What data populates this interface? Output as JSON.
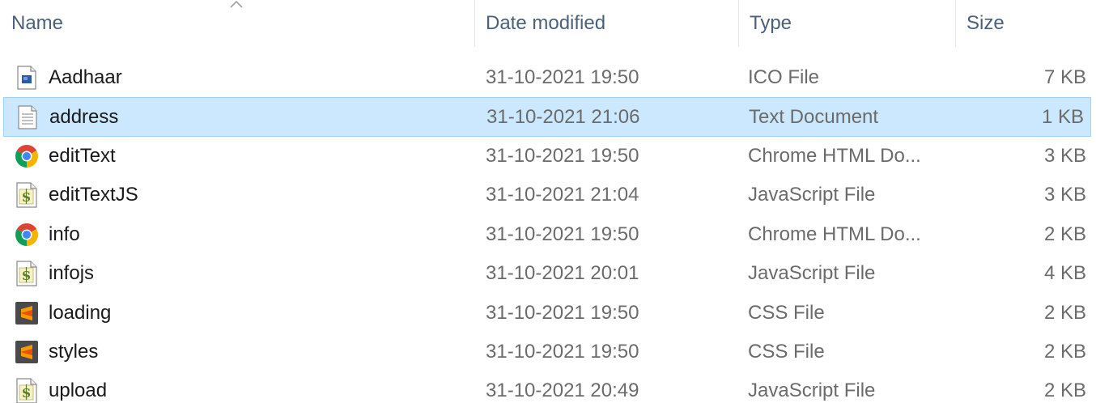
{
  "columns": {
    "name": "Name",
    "date": "Date modified",
    "type": "Type",
    "size": "Size"
  },
  "sort": {
    "column": "name",
    "direction": "ascending"
  },
  "colors": {
    "selection_background": "#cce8ff",
    "selection_border": "#99d1ff",
    "header_text": "#4c607a",
    "secondary_text": "#6b6b6b"
  },
  "files": [
    {
      "name": "Aadhaar",
      "date": "31-10-2021 19:50",
      "type": "ICO File",
      "size": "7 KB",
      "icon": "ico-file-icon",
      "selected": false
    },
    {
      "name": "address",
      "date": "31-10-2021 21:06",
      "type": "Text Document",
      "size": "1 KB",
      "icon": "text-document-icon",
      "selected": true
    },
    {
      "name": "editText",
      "date": "31-10-2021 19:50",
      "type": "Chrome HTML Do...",
      "size": "3 KB",
      "icon": "chrome-icon",
      "selected": false
    },
    {
      "name": "editTextJS",
      "date": "31-10-2021 21:04",
      "type": "JavaScript File",
      "size": "3 KB",
      "icon": "javascript-file-icon",
      "selected": false
    },
    {
      "name": "info",
      "date": "31-10-2021 19:50",
      "type": "Chrome HTML Do...",
      "size": "2 KB",
      "icon": "chrome-icon",
      "selected": false
    },
    {
      "name": "infojs",
      "date": "31-10-2021 20:01",
      "type": "JavaScript File",
      "size": "4 KB",
      "icon": "javascript-file-icon",
      "selected": false
    },
    {
      "name": "loading",
      "date": "31-10-2021 19:50",
      "type": "CSS File",
      "size": "2 KB",
      "icon": "sublime-css-icon",
      "selected": false
    },
    {
      "name": "styles",
      "date": "31-10-2021 19:50",
      "type": "CSS File",
      "size": "2 KB",
      "icon": "sublime-css-icon",
      "selected": false
    },
    {
      "name": "upload",
      "date": "31-10-2021 20:49",
      "type": "JavaScript File",
      "size": "2 KB",
      "icon": "javascript-file-icon",
      "selected": false
    }
  ]
}
